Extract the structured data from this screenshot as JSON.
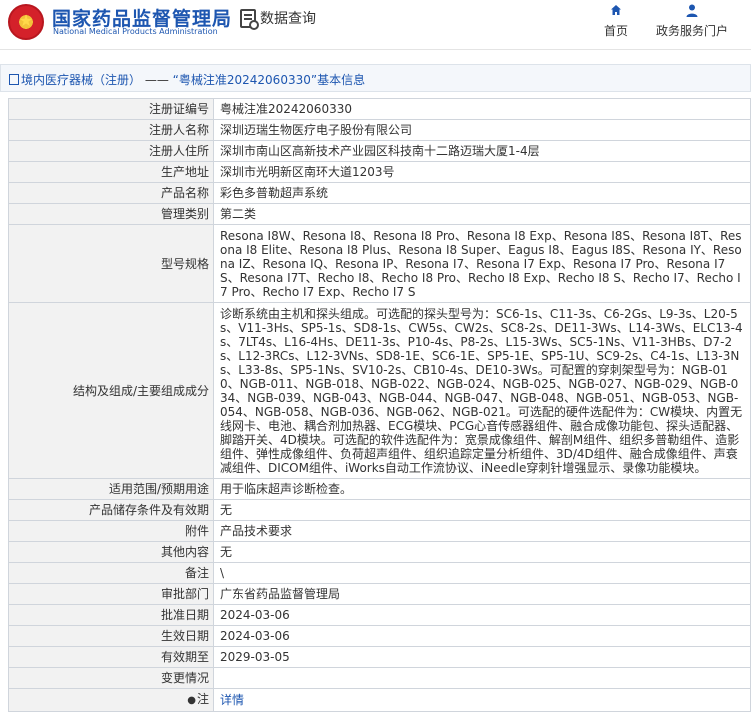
{
  "header": {
    "site_title": "国家药品监督管理局",
    "site_subtitle": "National Medical Products Administration",
    "query_label": "数据查询",
    "nav": [
      {
        "label": "首页",
        "icon": "home-icon"
      },
      {
        "label": "政务服务门户",
        "icon": "person-icon"
      }
    ]
  },
  "breadcrumb": {
    "category": "境内医疗器械（注册）",
    "separator": " —— ",
    "current": "“粤械注准20242060330”基本信息"
  },
  "detail": {
    "rows": [
      {
        "label": "注册证编号",
        "value": "粤械注准20242060330"
      },
      {
        "label": "注册人名称",
        "value": "深圳迈瑞生物医疗电子股份有限公司"
      },
      {
        "label": "注册人住所",
        "value": "深圳市南山区高新技术产业园区科技南十二路迈瑞大厦1-4层"
      },
      {
        "label": "生产地址",
        "value": "深圳市光明新区南环大道1203号"
      },
      {
        "label": "产品名称",
        "value": "彩色多普勒超声系统"
      },
      {
        "label": "管理类别",
        "value": "第二类"
      },
      {
        "label": "型号规格",
        "value": "Resona I8W、Resona I8、Resona I8 Pro、Resona I8 Exp、Resona I8S、Resona I8T、Resona I8 Elite、Resona I8 Plus、Resona I8 Super、Eagus I8、Eagus I8S、Resona IY、Resona IZ、Resona IQ、Resona IP、Resona I7、Resona I7 Exp、Resona I7 Pro、Resona I7S、Resona I7T、Recho I8、Recho I8 Pro、Recho I8 Exp、Recho I8 S、Recho I7、Recho I7 Pro、Recho I7 Exp、Recho I7 S"
      },
      {
        "label": "结构及组成/主要组成成分",
        "value": "诊断系统由主机和探头组成。可选配的探头型号为：SC6-1s、C11-3s、C6-2Gs、L9-3s、L20-5s、V11-3Hs、SP5-1s、SD8-1s、CW5s、CW2s、SC8-2s、DE11-3Ws、L14-3Ws、ELC13-4s、7LT4s、L16-4Hs、DE11-3s、P10-4s、P8-2s、L15-3Ws、SC5-1Ns、V11-3HBs、D7-2s、L12-3RCs、L12-3VNs、SD8-1E、SC6-1E、SP5-1E、SP5-1U、SC9-2s、C4-1s、L13-3Ns、L33-8s、SP5-1Ns、SV10-2s、CB10-4s、DE10-3Ws。可配置的穿刺架型号为：NGB-010、NGB-011、NGB-018、NGB-022、NGB-024、NGB-025、NGB-027、NGB-029、NGB-034、NGB-039、NGB-043、NGB-044、NGB-047、NGB-048、NGB-051、NGB-053、NGB-054、NGB-058、NGB-036、NGB-062、NGB-021。可选配的硬件选配件为：CW模块、内置无线网卡、电池、耦合剂加热器、ECG模块、PCG心音传感器组件、融合成像功能包、探头适配器、脚踏开关、4D模块。可选配的软件选配件为：宽景成像组件、解剖M组件、组织多普勒组件、造影组件、弹性成像组件、负荷超声组件、组织追踪定量分析组件、3D/4D组件、融合成像组件、声衰减组件、DICOM组件、iWorks自动工作流协议、iNeedle穿刺针增强显示、录像功能模块。"
      },
      {
        "label": "适用范围/预期用途",
        "value": "用于临床超声诊断检查。"
      },
      {
        "label": "产品储存条件及有效期",
        "value": "无"
      },
      {
        "label": "附件",
        "value": "产品技术要求"
      },
      {
        "label": "其他内容",
        "value": "无"
      },
      {
        "label": "备注",
        "value": "\\"
      },
      {
        "label": "审批部门",
        "value": "广东省药品监督管理局"
      },
      {
        "label": "批准日期",
        "value": "2024-03-06"
      },
      {
        "label": "生效日期",
        "value": "2024-03-06"
      },
      {
        "label": "有效期至",
        "value": "2029-03-05"
      },
      {
        "label": "变更情况",
        "value": ""
      },
      {
        "label": "注",
        "value": "详情",
        "icon": "pin-icon"
      }
    ]
  }
}
